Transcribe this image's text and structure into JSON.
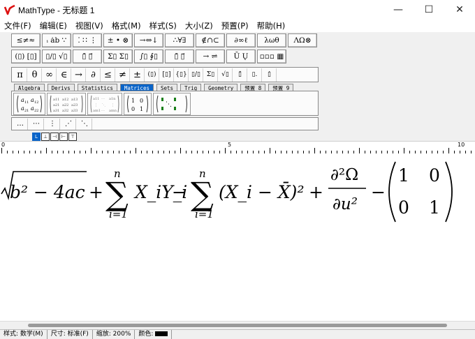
{
  "window": {
    "title": "MathType - 无标题 1",
    "minimize_glyph": "—",
    "maximize_glyph": "☐",
    "close_glyph": "✕"
  },
  "menu": [
    "文件(F)",
    "编辑(E)",
    "视图(V)",
    "格式(M)",
    "样式(S)",
    "大小(Z)",
    "预置(P)",
    "帮助(H)"
  ],
  "palette_row1": [
    "≤≠≈",
    "ᵢ ȧb ∵",
    "⁚ ∷ ⋮",
    "± • ⊗",
    "→⇔↓",
    "∴∀∃",
    "∉∩⊂",
    "∂∞ℓ",
    "λωθ",
    "ΛΩ⊗"
  ],
  "palette_row2": [
    "(▯) [▯]",
    "▯/▯ √▯",
    "▯̄ ▯⃗",
    "Σ▯ Σ▯",
    "∫▯ ∮▯",
    "▯̄ ▯⃗",
    "→ ⇌",
    "Ū Ų",
    "▫▫▫ ▦"
  ],
  "symbol_row": [
    "π",
    "θ",
    "∞",
    "∈",
    "→",
    "∂",
    "≤",
    "≠",
    "±",
    "(▯)",
    "[▯]",
    "{▯}",
    "▯/▯",
    "Σ▯",
    "√▯",
    "▯̄",
    "▯.",
    "▯̇"
  ],
  "tabs": [
    "Algebra",
    "Derivs",
    "Statistics",
    "Matrices",
    "Sets",
    "Trig",
    "Geometry",
    "预置 8",
    "预置 9"
  ],
  "active_tab": "Matrices",
  "matrix_templates": [
    {
      "name": "2x2 matrix",
      "glyph": "a₁₁ a₁₂ / a₂₁ a₂₂"
    },
    {
      "name": "3x3 matrix",
      "glyph": "a₁₁ a₁₂ a₁₃ …"
    },
    {
      "name": "general matrix",
      "glyph": "a₁₁ ⋯ a₁ₙ …"
    },
    {
      "name": "identity 2x2",
      "glyph": "1 0 / 0 1"
    },
    {
      "name": "diagonal dots",
      "glyph": "⋱"
    }
  ],
  "dots_row": [
    "…",
    "⋯",
    "⋮",
    "⋰",
    "⋱"
  ],
  "tab_stops": [
    "L",
    "⊥",
    "⊣",
    "⊢",
    "⊤"
  ],
  "ruler": {
    "marks": [
      "0",
      "5",
      "10"
    ]
  },
  "equation": {
    "sqrt_content": "b² − 4ac",
    "plus": "+",
    "sum_top": "n",
    "sum_bottom": "i=1",
    "sum_terms": "X_iY_i",
    "minus": "−",
    "paren_terms": "(X_i − X̄)²",
    "frac_num": "∂²Ω",
    "frac_den": "∂u²",
    "matrix": [
      [
        "1",
        "0"
      ],
      [
        "0",
        "1"
      ]
    ]
  },
  "status": {
    "style": "样式: 数学(M)",
    "size": "尺寸: 标准(F)",
    "zoom": "缩放: 200%",
    "color_label": "颜色:",
    "color": "#000000"
  }
}
